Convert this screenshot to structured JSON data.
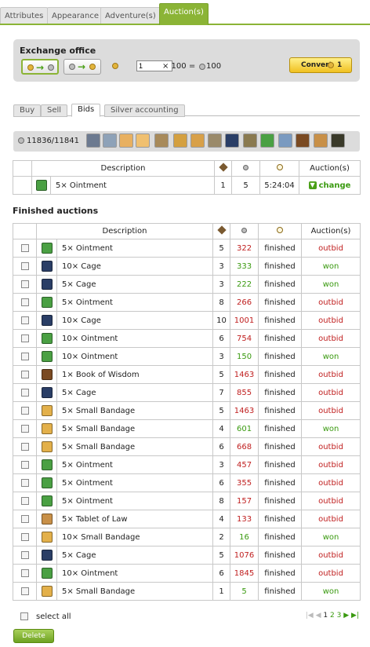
{
  "top_tabs": [
    {
      "label": "Attributes",
      "active": false
    },
    {
      "label": "Appearance",
      "active": false
    },
    {
      "label": "Adventure(s)",
      "active": false
    },
    {
      "label": "Auction(s)",
      "active": true
    }
  ],
  "exchange": {
    "title": "Exchange office",
    "input_value": "1",
    "multiplier_text": "× 100 =",
    "result_text": "100",
    "convert_label": "Convert",
    "convert_value": "1"
  },
  "sub_tabs": [
    {
      "label": "Buy",
      "active": false
    },
    {
      "label": "Sell",
      "active": false
    },
    {
      "label": "Bids",
      "active": true
    },
    {
      "label": "Silver accounting",
      "active": false
    }
  ],
  "toolbar": {
    "count": "11836/11841",
    "categories": [
      "helmet-icon",
      "armor-icon",
      "gloves-icon",
      "boots-icon",
      "shield-icon",
      "sword-icon",
      "ointment-icon",
      "cage-icon",
      "bandage-icon",
      "scroll-icon",
      "tablet-icon",
      "bucket-icon",
      "book-icon",
      "artwork-icon",
      "treasure-icon"
    ]
  },
  "bids_table": {
    "headers": {
      "description": "Description",
      "auction": "Auction(s)"
    },
    "rows": [
      {
        "icon": "ointment",
        "description": "5× Ointment",
        "count": "1",
        "silver": "5",
        "time": "5:24:04",
        "action": "change"
      }
    ]
  },
  "finished": {
    "title": "Finished auctions",
    "headers": {
      "description": "Description",
      "auction": "Auction(s)"
    },
    "rows": [
      {
        "icon": "ointment",
        "description": "5× Ointment",
        "bids": "5",
        "silver": "322",
        "status": "finished",
        "result": "outbid"
      },
      {
        "icon": "cage",
        "description": "10× Cage",
        "bids": "3",
        "silver": "333",
        "status": "finished",
        "result": "won"
      },
      {
        "icon": "cage",
        "description": "5× Cage",
        "bids": "3",
        "silver": "222",
        "status": "finished",
        "result": "won"
      },
      {
        "icon": "ointment",
        "description": "5× Ointment",
        "bids": "8",
        "silver": "266",
        "status": "finished",
        "result": "outbid"
      },
      {
        "icon": "cage",
        "description": "10× Cage",
        "bids": "10",
        "silver": "1001",
        "status": "finished",
        "result": "outbid"
      },
      {
        "icon": "ointment",
        "description": "10× Ointment",
        "bids": "6",
        "silver": "754",
        "status": "finished",
        "result": "outbid"
      },
      {
        "icon": "ointment",
        "description": "10× Ointment",
        "bids": "3",
        "silver": "150",
        "status": "finished",
        "result": "won"
      },
      {
        "icon": "book",
        "description": "1× Book of Wisdom",
        "bids": "5",
        "silver": "1463",
        "status": "finished",
        "result": "outbid"
      },
      {
        "icon": "cage",
        "description": "5× Cage",
        "bids": "7",
        "silver": "855",
        "status": "finished",
        "result": "outbid"
      },
      {
        "icon": "bandage",
        "description": "5× Small Bandage",
        "bids": "5",
        "silver": "1463",
        "status": "finished",
        "result": "outbid"
      },
      {
        "icon": "bandage",
        "description": "5× Small Bandage",
        "bids": "4",
        "silver": "601",
        "status": "finished",
        "result": "won"
      },
      {
        "icon": "bandage",
        "description": "5× Small Bandage",
        "bids": "6",
        "silver": "668",
        "status": "finished",
        "result": "outbid"
      },
      {
        "icon": "ointment",
        "description": "5× Ointment",
        "bids": "3",
        "silver": "457",
        "status": "finished",
        "result": "outbid"
      },
      {
        "icon": "ointment",
        "description": "5× Ointment",
        "bids": "6",
        "silver": "355",
        "status": "finished",
        "result": "outbid"
      },
      {
        "icon": "ointment",
        "description": "5× Ointment",
        "bids": "8",
        "silver": "157",
        "status": "finished",
        "result": "outbid"
      },
      {
        "icon": "tablet",
        "description": "5× Tablet of Law",
        "bids": "4",
        "silver": "133",
        "status": "finished",
        "result": "outbid"
      },
      {
        "icon": "bandage",
        "description": "10× Small Bandage",
        "bids": "2",
        "silver": "16",
        "status": "finished",
        "result": "won"
      },
      {
        "icon": "cage",
        "description": "5× Cage",
        "bids": "5",
        "silver": "1076",
        "status": "finished",
        "result": "outbid"
      },
      {
        "icon": "ointment",
        "description": "10× Ointment",
        "bids": "6",
        "silver": "1845",
        "status": "finished",
        "result": "outbid"
      },
      {
        "icon": "bandage",
        "description": "5× Small Bandage",
        "bids": "1",
        "silver": "5",
        "status": "finished",
        "result": "won"
      }
    ]
  },
  "footer": {
    "select_all": "select all",
    "pages": [
      "1",
      "2",
      "3"
    ],
    "current_page": "1",
    "delete_label": "Delete"
  },
  "colors": {
    "accent": "#8bb436",
    "outbid": "#c02020",
    "won": "#3a9a10"
  }
}
